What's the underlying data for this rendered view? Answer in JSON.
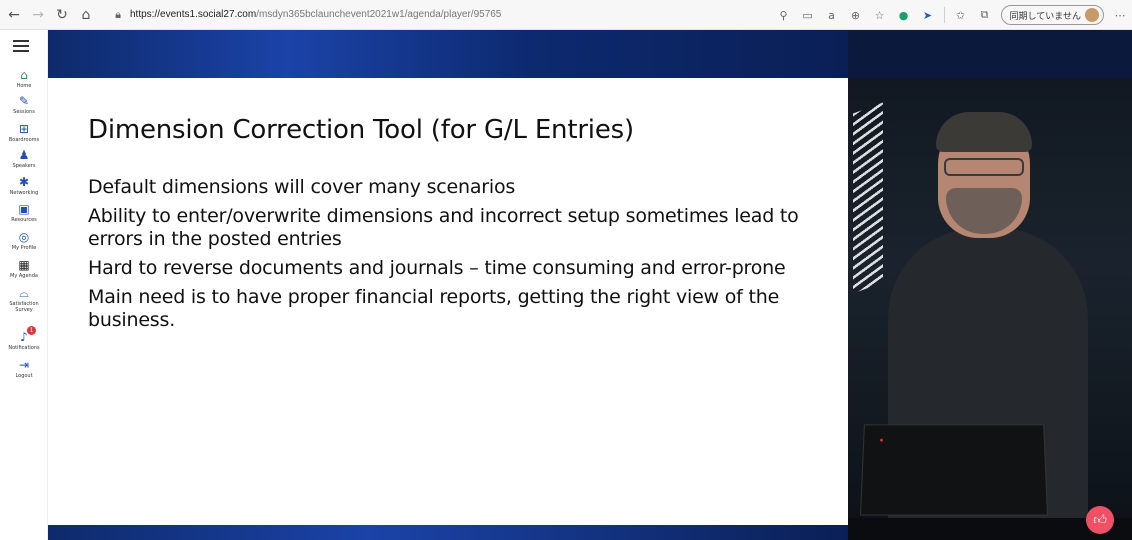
{
  "browser": {
    "url_host": "https://events1.social27.com",
    "url_path": "/msdyn365bclaunchevent2021w1/agenda/player/95765",
    "profile_label": "同期していません",
    "icons": [
      "back-icon",
      "forward-icon",
      "refresh-icon",
      "home-icon",
      "lock-icon",
      "search-icon",
      "immersive-reader-icon",
      "read-aloud-icon",
      "zoom-icon",
      "add-favorite-icon",
      "extension-icon",
      "extension-icon",
      "favorites-icon",
      "collections-icon",
      "more-icon"
    ]
  },
  "sidebar": {
    "items": [
      {
        "label": "Home",
        "icon": "home-icon"
      },
      {
        "label": "Sessions",
        "icon": "pencil-icon"
      },
      {
        "label": "Boardrooms",
        "icon": "boardroom-icon"
      },
      {
        "label": "Speakers",
        "icon": "speaker-icon"
      },
      {
        "label": "Networking",
        "icon": "networking-icon"
      },
      {
        "label": "Resources",
        "icon": "resources-icon"
      },
      {
        "label": "My Profile",
        "icon": "profile-icon"
      },
      {
        "label": "My Agenda",
        "icon": "calendar-icon"
      },
      {
        "label": "Satisfaction Survey",
        "icon": "survey-icon"
      },
      {
        "label": "Notifications",
        "icon": "bell-icon",
        "badge": "1"
      },
      {
        "label": "Logout",
        "icon": "logout-icon"
      }
    ]
  },
  "slide": {
    "title": "Dimension Correction Tool (for G/L Entries)",
    "bullets": [
      "Default dimensions will cover many scenarios",
      "Ability to enter/overwrite dimensions and incorrect setup sometimes lead to errors in the posted entries",
      "Hard to reverse documents and journals – time consuming and error-prone",
      "Main need is to have proper financial reports, getting the right view of the business."
    ]
  },
  "controls": {
    "like_icon": "thumbs-up-icon"
  },
  "colors": {
    "accent": "#1f4fb0",
    "like": "#f05065",
    "badge": "#e0353b",
    "band": "#1b43a8"
  }
}
